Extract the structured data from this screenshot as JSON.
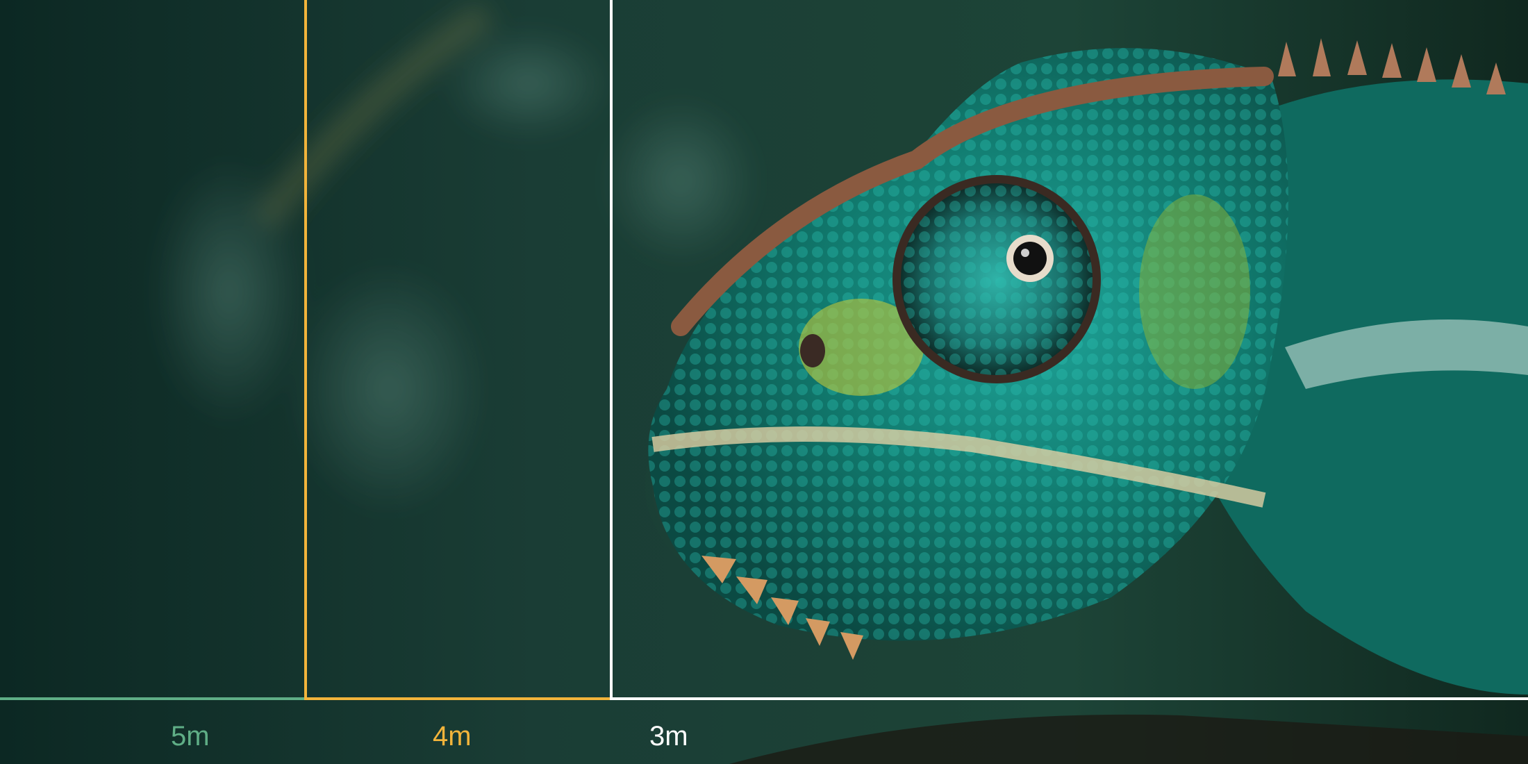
{
  "scene": {
    "subject": "chameleon",
    "colors": {
      "zone_5m": "#5fae86",
      "zone_4m": "#f2b43b",
      "zone_3m": "#ffffff"
    }
  },
  "distance_labels": {
    "zone_5m": "5m",
    "zone_4m": "4m",
    "zone_3m": "3m"
  }
}
